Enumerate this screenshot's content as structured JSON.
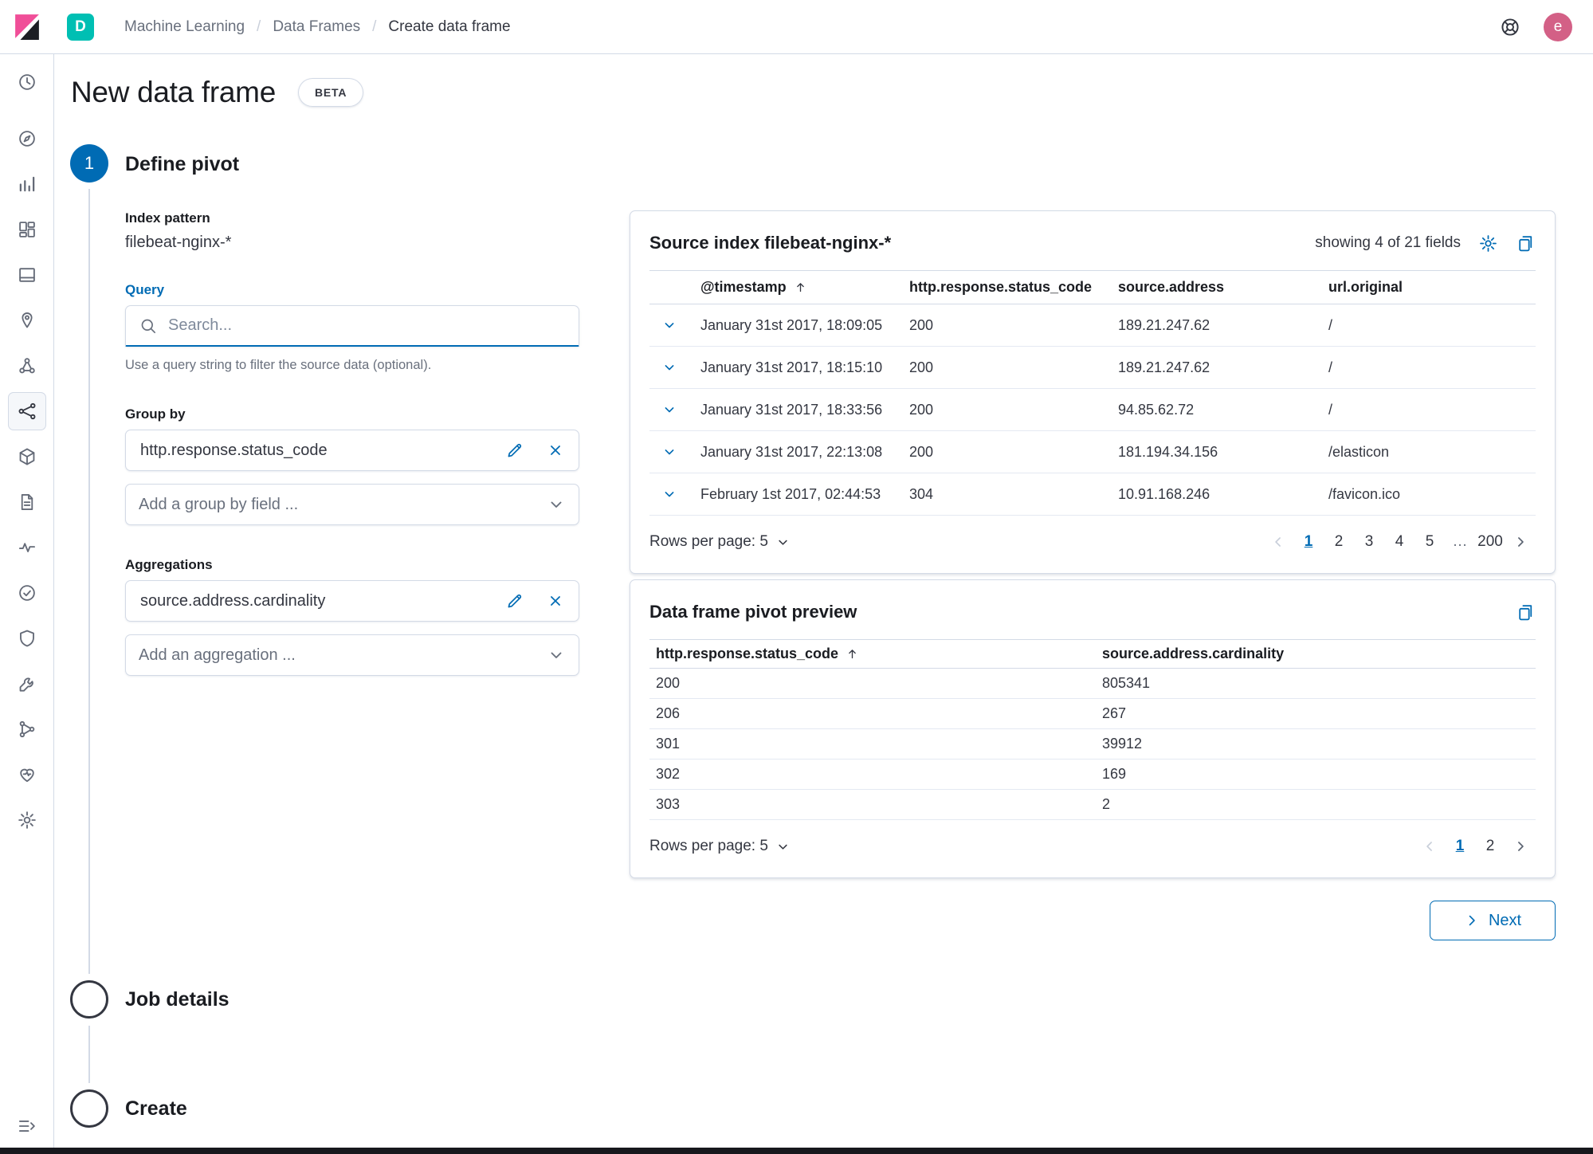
{
  "colors": {
    "primary": "#006BB4",
    "space_badge_teal": "#00BFB3",
    "logo_pink": "#F04E98",
    "avatar_pink": "#D36086",
    "border": "#D3DAE6"
  },
  "header": {
    "space_badge": "D",
    "breadcrumbs": [
      "Machine Learning",
      "Data Frames",
      "Create data frame"
    ],
    "avatar_initial": "e"
  },
  "sidebar": {
    "items": [
      "recently-viewed",
      "discover",
      "visualize",
      "dashboard",
      "canvas",
      "maps",
      "graph",
      "machine-learning",
      "infrastructure",
      "logs",
      "apm",
      "uptime",
      "siem",
      "dev-tools",
      "pipelines",
      "monitoring",
      "management"
    ],
    "active": "machine-learning"
  },
  "page": {
    "title": "New data frame",
    "beta_badge": "BETA"
  },
  "steps": [
    {
      "number": "1",
      "label": "Define pivot"
    },
    {
      "label": "Job details"
    },
    {
      "label": "Create"
    }
  ],
  "form": {
    "index_pattern_label": "Index pattern",
    "index_pattern_value": "filebeat-nginx-*",
    "query_label": "Query",
    "query_placeholder": "Search...",
    "query_help": "Use a query string to filter the source data (optional).",
    "group_by_label": "Group by",
    "group_by_item": "http.response.status_code",
    "group_by_add_placeholder": "Add a group by field ...",
    "aggregations_label": "Aggregations",
    "aggregation_item": "source.address.cardinality",
    "aggregation_add_placeholder": "Add an aggregation ..."
  },
  "source_panel": {
    "title": "Source index filebeat-nginx-*",
    "fields_summary": "showing 4 of 21 fields",
    "columns": [
      "@timestamp",
      "http.response.status_code",
      "source.address",
      "url.original"
    ],
    "rows": [
      [
        "January 31st 2017, 18:09:05",
        "200",
        "189.21.247.62",
        "/"
      ],
      [
        "January 31st 2017, 18:15:10",
        "200",
        "189.21.247.62",
        "/"
      ],
      [
        "January 31st 2017, 18:33:56",
        "200",
        "94.85.62.72",
        "/"
      ],
      [
        "January 31st 2017, 22:13:08",
        "200",
        "181.194.34.156",
        "/elasticon"
      ],
      [
        "February 1st 2017, 02:44:53",
        "304",
        "10.91.168.246",
        "/favicon.ico"
      ]
    ],
    "rows_per_page": "Rows per page: 5",
    "pages": [
      "1",
      "2",
      "3",
      "4",
      "5",
      "…",
      "200"
    ],
    "active_page": "1"
  },
  "pivot_panel": {
    "title": "Data frame pivot preview",
    "columns": [
      "http.response.status_code",
      "source.address.cardinality"
    ],
    "rows": [
      [
        "200",
        "805341"
      ],
      [
        "206",
        "267"
      ],
      [
        "301",
        "39912"
      ],
      [
        "302",
        "169"
      ],
      [
        "303",
        "2"
      ]
    ],
    "rows_per_page": "Rows per page: 5",
    "pages": [
      "1",
      "2"
    ],
    "active_page": "1"
  },
  "next_button_label": "Next"
}
